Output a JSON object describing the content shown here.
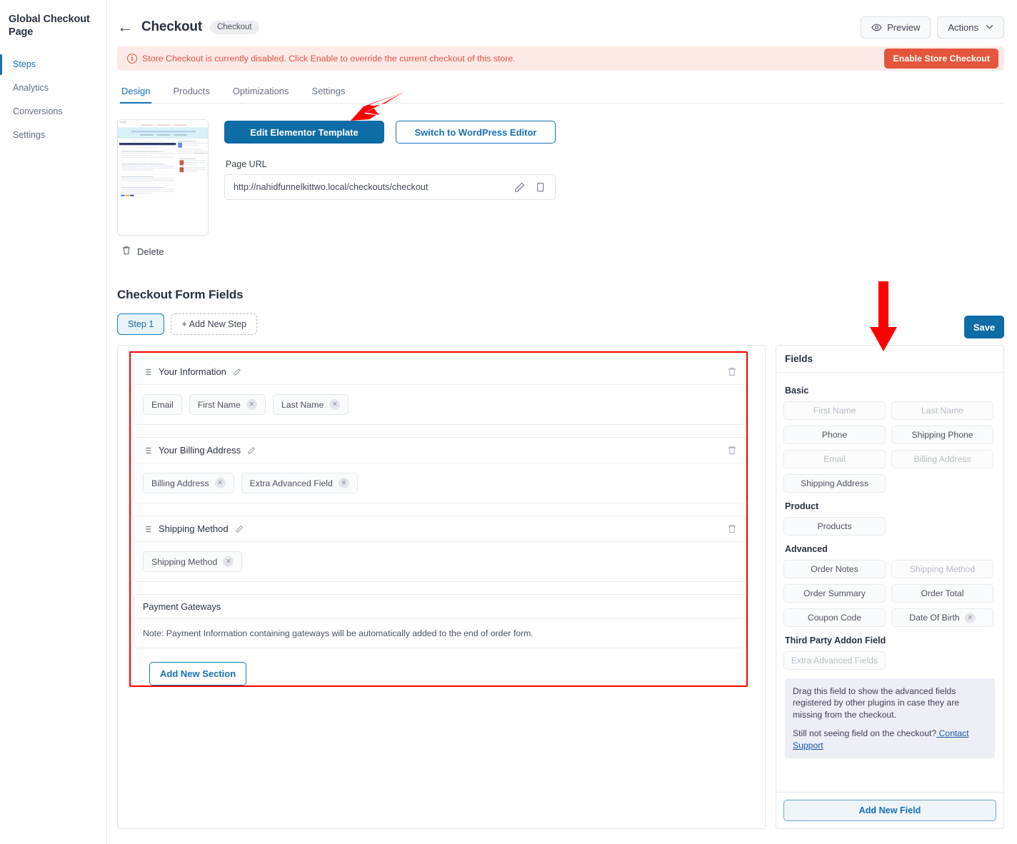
{
  "sidebar": {
    "brand": "Global Checkout Page",
    "items": [
      {
        "label": "Steps",
        "active": true
      },
      {
        "label": "Analytics",
        "active": false
      },
      {
        "label": "Conversions",
        "active": false
      },
      {
        "label": "Settings",
        "active": false
      }
    ]
  },
  "topbar": {
    "back_icon": "back-arrow-icon",
    "title": "Checkout",
    "chip": "Checkout",
    "preview_label": "Preview",
    "preview_icon": "eye-icon",
    "actions_label": "Actions",
    "actions_icon": "chevron-down-icon"
  },
  "notice": {
    "icon": "info-circle-icon",
    "text": "Store Checkout is currently disabled. Click Enable to override the current checkout of this store.",
    "button_label": "Enable Store Checkout",
    "bg_color": "#fdeae7",
    "text_color": "#e0533c",
    "button_color": "#e4563c"
  },
  "tabs": [
    {
      "label": "Design",
      "active": true
    },
    {
      "label": "Products",
      "active": false
    },
    {
      "label": "Optimizations",
      "active": false
    },
    {
      "label": "Settings",
      "active": false
    }
  ],
  "design": {
    "thumbnail_name": "checkout-page-thumbnail",
    "delete_label": "Delete",
    "delete_icon": "trash-icon",
    "edit_template_label": "Edit Elementor Template",
    "switch_editor_label": "Switch to WordPress Editor",
    "url_label": "Page URL",
    "url_value": "http://nahidfunnelkittwo.local/checkouts/checkout",
    "url_edit_icon": "pencil-icon",
    "url_copy_icon": "copy-icon",
    "primary_color": "#0e6ca6"
  },
  "form_fields": {
    "heading": "Checkout Form Fields",
    "step_chip": "Step 1",
    "add_step_label": "+ Add New Step",
    "save_label": "Save",
    "add_section_label": "Add New Section",
    "sections": [
      {
        "name": "Your Information",
        "grip_icon": "drag-list-icon",
        "edit_icon": "pencil-icon",
        "delete_icon": "trash-icon",
        "deletable": true,
        "fields": [
          {
            "label": "Email",
            "removable": false
          },
          {
            "label": "First Name",
            "removable": true
          },
          {
            "label": "Last Name",
            "removable": true
          }
        ]
      },
      {
        "name": "Your Billing Address",
        "grip_icon": "drag-list-icon",
        "edit_icon": "pencil-icon",
        "delete_icon": "trash-icon",
        "deletable": true,
        "fields": [
          {
            "label": "Billing Address",
            "removable": true
          },
          {
            "label": "Extra Advanced Field",
            "removable": true
          }
        ]
      },
      {
        "name": "Shipping Method",
        "grip_icon": "drag-list-icon",
        "edit_icon": "pencil-icon",
        "delete_icon": "trash-icon",
        "deletable": true,
        "fields": [
          {
            "label": "Shipping Method",
            "removable": true
          }
        ]
      }
    ],
    "payment_gateways": {
      "title": "Payment Gateways",
      "note": "Note: Payment Information containing gateways will be automatically added to the end of order form."
    },
    "highlight_color": "#fe0000"
  },
  "fields_panel": {
    "title": "Fields",
    "groups": [
      {
        "title": "Basic",
        "chips": [
          {
            "label": "First Name",
            "disabled": true,
            "removable": false
          },
          {
            "label": "Last Name",
            "disabled": true,
            "removable": false
          },
          {
            "label": "Phone",
            "disabled": false,
            "removable": false
          },
          {
            "label": "Shipping Phone",
            "disabled": false,
            "removable": false
          },
          {
            "label": "Email",
            "disabled": true,
            "removable": false
          },
          {
            "label": "Billing Address",
            "disabled": true,
            "removable": false
          },
          {
            "label": "Shipping Address",
            "disabled": false,
            "removable": false
          }
        ]
      },
      {
        "title": "Product",
        "chips": [
          {
            "label": "Products",
            "disabled": false,
            "removable": false
          }
        ]
      },
      {
        "title": "Advanced",
        "chips": [
          {
            "label": "Order Notes",
            "disabled": false,
            "removable": false
          },
          {
            "label": "Shipping Method",
            "disabled": true,
            "removable": false
          },
          {
            "label": "Order Summary",
            "disabled": false,
            "removable": false
          },
          {
            "label": "Order Total",
            "disabled": false,
            "removable": false
          },
          {
            "label": "Coupon Code",
            "disabled": false,
            "removable": false
          },
          {
            "label": "Date Of Birth",
            "disabled": false,
            "removable": true
          }
        ]
      },
      {
        "title": "Third Party Addon Field",
        "chips": [
          {
            "label": "Extra Advanced Fields",
            "disabled": true,
            "removable": false
          }
        ]
      }
    ],
    "info_line1": "Drag this field to show the advanced fields registered by other plugins in case they are missing from the checkout.",
    "info_line2_text": "Still not seeing field on the checkout?",
    "info_link": " Contact Support",
    "add_field_label": "Add New Field"
  },
  "annotations": {
    "arrow_color": "#fe0000",
    "arrow_tabs": "arrow-pointing-to-design-tab",
    "arrow_fields": "arrow-pointing-to-fields-panel"
  }
}
